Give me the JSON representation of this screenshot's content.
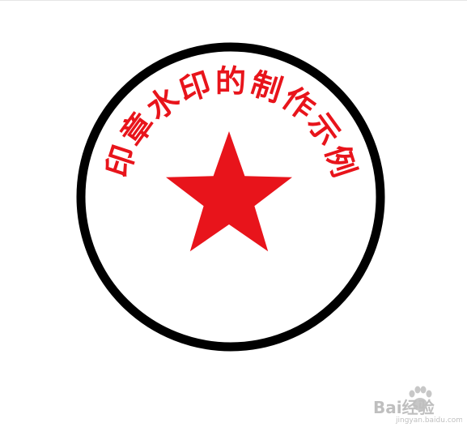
{
  "stamp": {
    "arc_text": "印章水印的制作示例",
    "ring_color": "#000000",
    "text_color": "#e8141b",
    "star_color": "#e8141b",
    "icon": "five-pointed-star"
  },
  "watermark": {
    "brand": "Bai经验",
    "site": "jingyan.baidu.com"
  }
}
